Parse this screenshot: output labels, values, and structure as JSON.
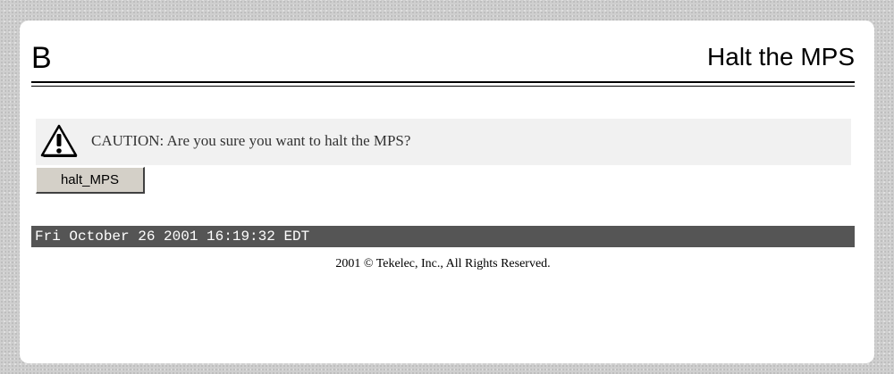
{
  "header": {
    "section_letter": "B",
    "title": "Halt the MPS"
  },
  "caution": {
    "icon": "warning-triangle-icon",
    "text": "CAUTION: Are you sure you want to halt the MPS?"
  },
  "actions": {
    "halt_label": "halt_MPS"
  },
  "status_bar": {
    "datetime": "Fri October 26 2001 16:19:32 EDT"
  },
  "footer": {
    "copyright": "2001 © Tekelec, Inc., All Rights Reserved."
  },
  "colors": {
    "status_bar_bg": "#555555",
    "caution_bg": "#f1f1f1",
    "button_face": "#d4d0c8"
  }
}
